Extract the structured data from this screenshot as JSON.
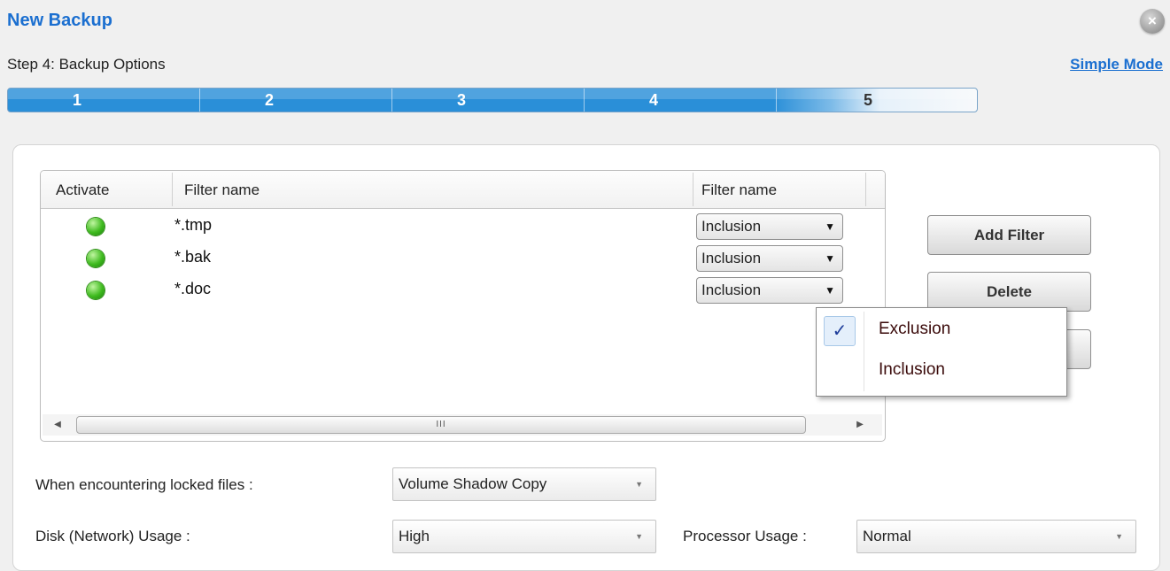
{
  "window": {
    "title": "New Backup",
    "close_icon": "close-icon",
    "step_label": "Step 4: Backup Options",
    "simple_mode_link": "Simple Mode"
  },
  "progress": {
    "steps": [
      "1",
      "2",
      "3",
      "4",
      "5"
    ],
    "current_step": 4,
    "accent_color": "#2a8fd8"
  },
  "filter_table": {
    "headers": [
      "Activate",
      "Filter name",
      "Filter name"
    ],
    "rows": [
      {
        "active": true,
        "name": "*.tmp",
        "type": "Inclusion"
      },
      {
        "active": true,
        "name": "*.bak",
        "type": "Inclusion"
      },
      {
        "active": true,
        "name": "*.doc",
        "type": "Inclusion"
      }
    ],
    "scrollbar_thumb_grip": "III",
    "active_dot_color": "#3fbb1f"
  },
  "buttons": {
    "add_filter": "Add Filter",
    "delete": "Delete"
  },
  "dropdown_menu": {
    "items": [
      {
        "label": "Exclusion",
        "checked": true
      },
      {
        "label": "Inclusion",
        "checked": false
      }
    ],
    "check_mark": "✓"
  },
  "options": {
    "locked_files_label": "When encountering locked files :",
    "locked_files_value": "Volume Shadow Copy",
    "disk_usage_label": "Disk (Network) Usage :",
    "disk_usage_value": "High",
    "processor_usage_label": "Processor Usage :",
    "processor_usage_value": "Normal"
  }
}
